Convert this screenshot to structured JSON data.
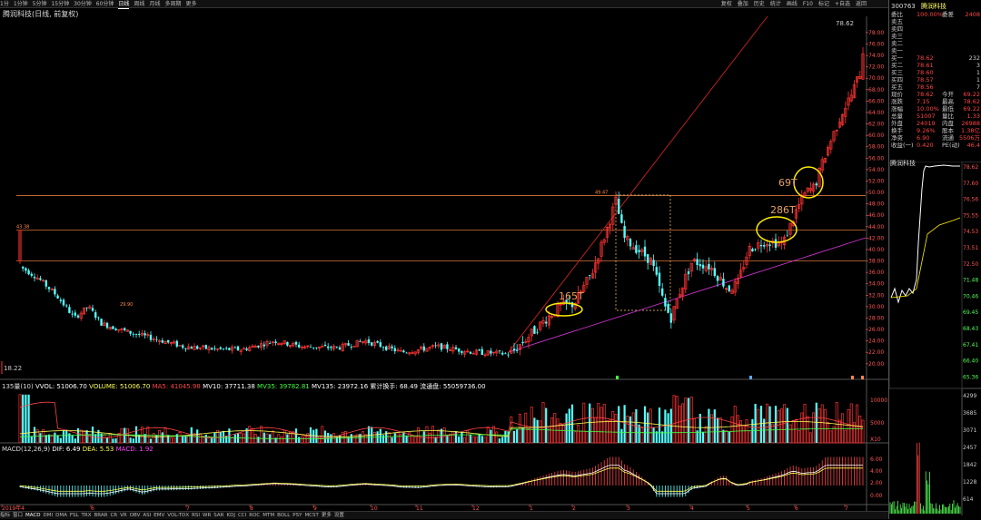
{
  "toolbar": {
    "periods": [
      "1分",
      "1分钟",
      "5分钟",
      "15分钟",
      "30分钟",
      "60分钟",
      "日线",
      "周线",
      "月线",
      "多周期",
      "更多"
    ],
    "active_period": "日线",
    "right_buttons": [
      "复权",
      "叠加",
      "历史",
      "统计",
      "画线",
      "F10",
      "标记",
      "+自选",
      "返回"
    ]
  },
  "chart_title": "腾润科技(日线, 前复权)",
  "price_labels": {
    "high_label": "78.62",
    "low_label": "18.22",
    "peak1": "43.38",
    "peak2": "49.47",
    "small1": "29.90"
  },
  "annotations": [
    {
      "text": "165T"
    },
    {
      "text": "286T"
    },
    {
      "text": "69T"
    }
  ],
  "y_axis_labels": [
    "78.00",
    "76.00",
    "74.00",
    "72.00",
    "70.00",
    "68.00",
    "66.00",
    "64.00",
    "62.00",
    "60.00",
    "58.00",
    "56.00",
    "54.00",
    "52.00",
    "50.00",
    "48.00",
    "46.00",
    "44.00",
    "42.00",
    "40.00",
    "38.00",
    "36.00",
    "34.00",
    "32.00",
    "30.00",
    "28.00",
    "26.00",
    "24.00",
    "22.00",
    "20.00"
  ],
  "vol_axis_labels": [
    "10000",
    "5000",
    "X10"
  ],
  "macd_axis_labels": [
    "6.00",
    "4.00",
    "2.00",
    "0.00"
  ],
  "x_axis_labels": [
    "2019年4",
    "6",
    "7",
    "8",
    "9",
    "10",
    "11",
    "12",
    "1",
    "2",
    "3",
    "4",
    "5",
    "6",
    "7"
  ],
  "volume_line": {
    "label": "135量(10)",
    "items": [
      {
        "k": "VVOL:",
        "v": "51006.70",
        "color": "#ffffff"
      },
      {
        "k": "VOLUME:",
        "v": "51006.70",
        "color": "#ffff55"
      },
      {
        "k": "MA5:",
        "v": "41045.98",
        "color": "#ff4444"
      },
      {
        "k": "MV10:",
        "v": "37711.38",
        "color": "#ffffff"
      },
      {
        "k": "MV35:",
        "v": "39782.81",
        "color": "#44ff44"
      },
      {
        "k": "MV135:",
        "v": "23972.16",
        "color": "#ffffff"
      },
      {
        "k": "累计换手:",
        "v": "68.49",
        "color": "#ffffff"
      },
      {
        "k": "流通盘:",
        "v": "55059736.00",
        "color": "#ffffff"
      }
    ]
  },
  "macd_line": {
    "label": "MACD(12,26,9)",
    "items": [
      {
        "k": "DIF:",
        "v": "6.49",
        "color": "#ffffff"
      },
      {
        "k": "DEA:",
        "v": "5.53",
        "color": "#ffff55"
      },
      {
        "k": "MACD:",
        "v": "1.92",
        "color": "#ff44ff"
      }
    ]
  },
  "bottom_tabs": [
    "指标",
    "窗口",
    "MACD",
    "DMI",
    "DMA",
    "FSL",
    "TRX",
    "BRAR",
    "CR",
    "VR",
    "OBV",
    "ASI",
    "EMV",
    "VOL-TDX",
    "RSI",
    "WR",
    "SAR",
    "KDJ",
    "CCI",
    "ROC",
    "MTM",
    "BOLL",
    "PSY",
    "MCST",
    "更多",
    "设置"
  ],
  "right_panel": {
    "code": "300763",
    "name": "腾润科技",
    "weibi": {
      "label": "委比",
      "val": "100.00%",
      "label2": "委差",
      "val2": "2408"
    },
    "sell_rows": [
      {
        "label": "卖五",
        "price": "",
        "vol": ""
      },
      {
        "label": "卖四",
        "price": "",
        "vol": ""
      },
      {
        "label": "卖三",
        "price": "",
        "vol": ""
      },
      {
        "label": "卖二",
        "price": "",
        "vol": ""
      },
      {
        "label": "卖一",
        "price": "",
        "vol": ""
      }
    ],
    "buy_rows": [
      {
        "label": "买一",
        "price": "78.62",
        "vol": "232"
      },
      {
        "label": "买二",
        "price": "78.61",
        "vol": "3"
      },
      {
        "label": "买三",
        "price": "78.60",
        "vol": "1"
      },
      {
        "label": "买四",
        "price": "78.57",
        "vol": "1"
      },
      {
        "label": "买五",
        "price": "78.56",
        "vol": "7"
      }
    ],
    "stats": [
      {
        "a": "现价",
        "b": "78.62",
        "d": "今开",
        "e": "69.22"
      },
      {
        "a": "涨跌",
        "b": "7.15",
        "d": "最高",
        "e": "78.62"
      },
      {
        "a": "涨幅",
        "b": "10.00%",
        "d": "最低",
        "e": "69.22"
      },
      {
        "a": "总量",
        "b": "51007",
        "d": "量比",
        "e": "1.33"
      },
      {
        "a": "外盘",
        "b": "24019",
        "d": "内盘",
        "e": "26988"
      },
      {
        "a": "换手",
        "b": "9.26%",
        "d": "股本",
        "e": "1.38亿"
      },
      {
        "a": "净资",
        "b": "6.90",
        "d": "流通",
        "e": "5506万"
      },
      {
        "a": "收益(一)",
        "b": "0.420",
        "d": "PE(动)",
        "e": "46.4"
      }
    ],
    "mini_axis": [
      "78.62",
      "77.60",
      "76.56",
      "75.55",
      "74.53",
      "73.51",
      "72.50",
      "71.48",
      "70.46",
      "69.45",
      "68.43",
      "67.41",
      "66.40",
      "65.36"
    ],
    "mini_vol_axis": [
      "4299",
      "3685",
      "3071",
      "2457",
      "1842",
      "1228",
      "614"
    ]
  },
  "colors": {
    "up": "#ff3333",
    "down": "#55ffff",
    "hline": "#ff8844",
    "trend_up": "#cc2222",
    "trend_magenta": "#cc33cc",
    "circle": "#ffee00"
  },
  "chart_data": {
    "type": "candlestick",
    "title": "腾润科技(日线, 前复权)",
    "price_range": [
      18.22,
      78.62
    ],
    "x_labels": [
      "2019年4",
      "6",
      "7",
      "8",
      "9",
      "10",
      "11",
      "12",
      "1",
      "2",
      "3",
      "4",
      "5",
      "6",
      "7"
    ],
    "key_levels": [
      43.38,
      49.47,
      38.0
    ],
    "last_price": 78.62,
    "macd": {
      "dif": 6.49,
      "dea": 5.53,
      "macd": 1.92
    },
    "volume": 51006.7
  }
}
